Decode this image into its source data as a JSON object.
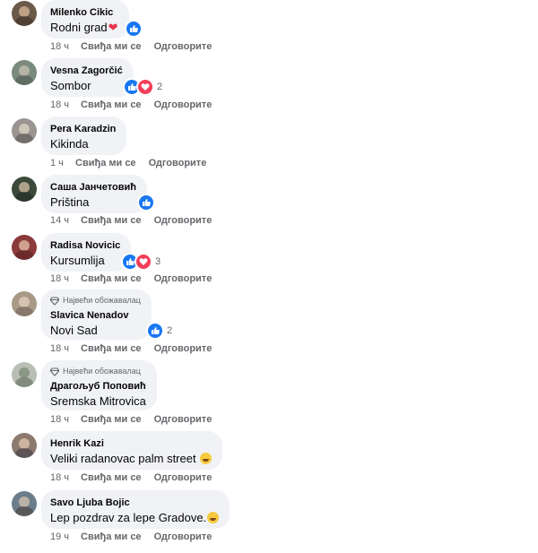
{
  "colors": {
    "like_blue": "#1877f2",
    "love_red": "#f33e58",
    "bubble_bg": "#f0f2f5",
    "meta_gray": "#65676b"
  },
  "comments": [
    {
      "name": "Milenko Cikic",
      "text": "Rodni grad",
      "text_suffix": "heart-emoji",
      "time": "18 ч",
      "like": "Свиђа ми се",
      "reply": "Одговорите",
      "reactions": [
        "like"
      ],
      "count": ""
    },
    {
      "name": "Vesna Zagorčić",
      "text": "Sombor",
      "time": "18 ч",
      "like": "Свиђа ми се",
      "reply": "Одговорите",
      "reactions": [
        "like",
        "love"
      ],
      "count": "2"
    },
    {
      "name": "Pera Karadzin",
      "text": "Kikinda",
      "time": "1 ч",
      "like": "Свиђа ми се",
      "reply": "Одговорите",
      "reactions": [],
      "count": ""
    },
    {
      "name": "Саша Јанчетовић",
      "text": "Priština",
      "time": "14 ч",
      "like": "Свиђа ми се",
      "reply": "Одговорите",
      "reactions": [
        "like"
      ],
      "count": ""
    },
    {
      "name": "Radisa Novicic",
      "text": "Kursumlija",
      "time": "18 ч",
      "like": "Свиђа ми се",
      "reply": "Одговорите",
      "reactions": [
        "like",
        "love"
      ],
      "count": "3"
    },
    {
      "badge": "Највећи обожавалац",
      "name": "Slavica Nenadov",
      "text": "Novi Sad",
      "time": "18 ч",
      "like": "Свиђа ми се",
      "reply": "Одговорите",
      "reactions": [
        "like"
      ],
      "count": "2"
    },
    {
      "badge": "Највећи обожавалац",
      "name": "Драгољуб Поповић",
      "text": "Sremska Mitrovica",
      "time": "18 ч",
      "like": "Свиђа ми се",
      "reply": "Одговорите",
      "reactions": [],
      "count": ""
    },
    {
      "name": "Henrik Kazi",
      "text": "Veliki radanovac palm street",
      "text_suffix": "smile-emoji",
      "time": "18 ч",
      "like": "Свиђа ми се",
      "reply": "Одговорите",
      "reactions": [],
      "count": ""
    },
    {
      "name": "Savo Ljuba Bojic",
      "text": "Lep pozdrav za lepe Gradove.",
      "text_suffix": "smile-emoji",
      "time": "19 ч",
      "like": "Свиђа ми се",
      "reply": "Одговорите",
      "reactions": [],
      "count": ""
    }
  ]
}
